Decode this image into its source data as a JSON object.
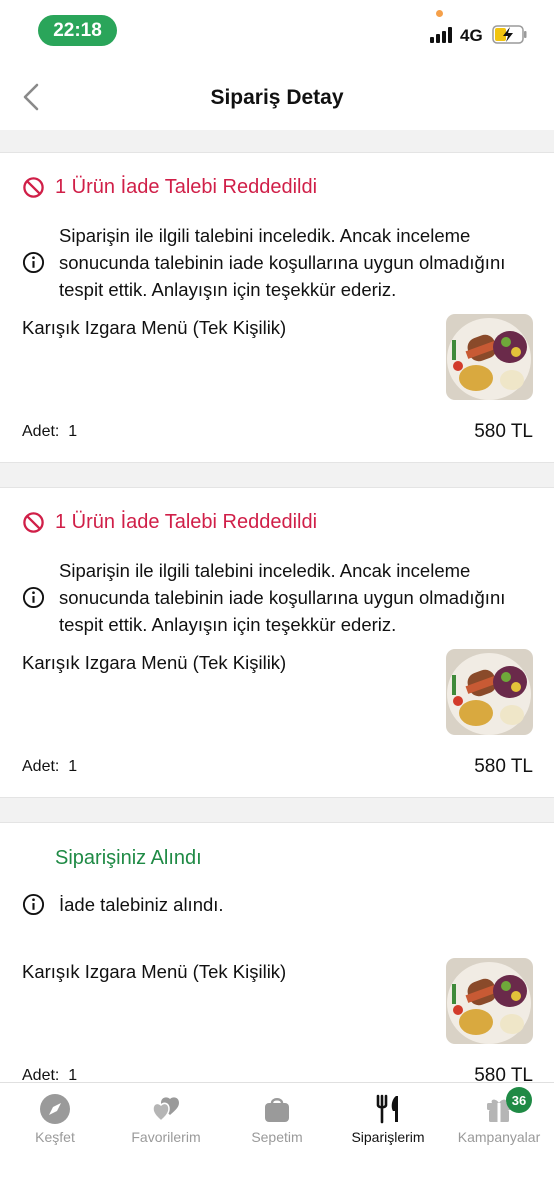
{
  "status_bar": {
    "time": "22:18",
    "network": "4G"
  },
  "header": {
    "title": "Sipariş Detay"
  },
  "cards": [
    {
      "status": "1 Ürün İade Talebi Reddedildi",
      "note": "Siparişin ile ilgili talebini inceledik. Ancak inceleme sonucunda talebinin iade koşullarına uygun olmadığını tespit ettik. Anlayışın için teşekkür ederiz.",
      "product": "Karışık Izgara Menü (Tek Kişilik)",
      "qty_label": "Adet:",
      "qty": "1",
      "price": "580 TL"
    },
    {
      "status": "1 Ürün İade Talebi Reddedildi",
      "note": "Siparişin ile ilgili talebini inceledik. Ancak inceleme sonucunda talebinin iade koşullarına uygun olmadığını tespit ettik. Anlayışın için teşekkür ederiz.",
      "product": "Karışık Izgara Menü (Tek Kişilik)",
      "qty_label": "Adet:",
      "qty": "1",
      "price": "580 TL"
    },
    {
      "status": "Siparişiniz Alındı",
      "note": "İade talebiniz alındı.",
      "product": "Karışık Izgara Menü (Tek Kişilik)",
      "qty_label": "Adet:",
      "qty": "1",
      "price": "580 TL"
    }
  ],
  "tabs": [
    {
      "label": "Keşfet",
      "icon": "compass-icon"
    },
    {
      "label": "Favorilerim",
      "icon": "hearts-icon"
    },
    {
      "label": "Sepetim",
      "icon": "shopping-bag-icon"
    },
    {
      "label": "Siparişlerim",
      "icon": "fork-knife-icon",
      "active": true
    },
    {
      "label": "Kampanyalar",
      "icon": "gift-icon",
      "badge": "36"
    }
  ],
  "colors": {
    "rejected": "#d01f48",
    "accepted": "#1f8a45",
    "time_pill": "#2aa55a"
  }
}
